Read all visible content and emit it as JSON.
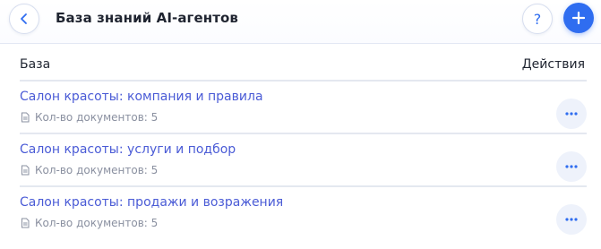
{
  "header": {
    "title": "База знаний AI-агентов",
    "back_icon": "chevron-left-icon",
    "help_label": "?",
    "add_icon": "plus-icon",
    "accent_color": "#2f6df0"
  },
  "table": {
    "columns": {
      "base": "База",
      "actions": "Действия"
    },
    "rows": [
      {
        "title": "Салон красоты: компания и правила",
        "doc_count_label": "Кол-во документов: 5",
        "action_icon": "more-horizontal-icon"
      },
      {
        "title": "Салон красоты: услуги и подбор",
        "doc_count_label": "Кол-во документов: 5",
        "action_icon": "more-horizontal-icon"
      },
      {
        "title": "Салон красоты: продажи и возражения",
        "doc_count_label": "Кол-во документов: 5",
        "action_icon": "more-horizontal-icon"
      }
    ]
  }
}
